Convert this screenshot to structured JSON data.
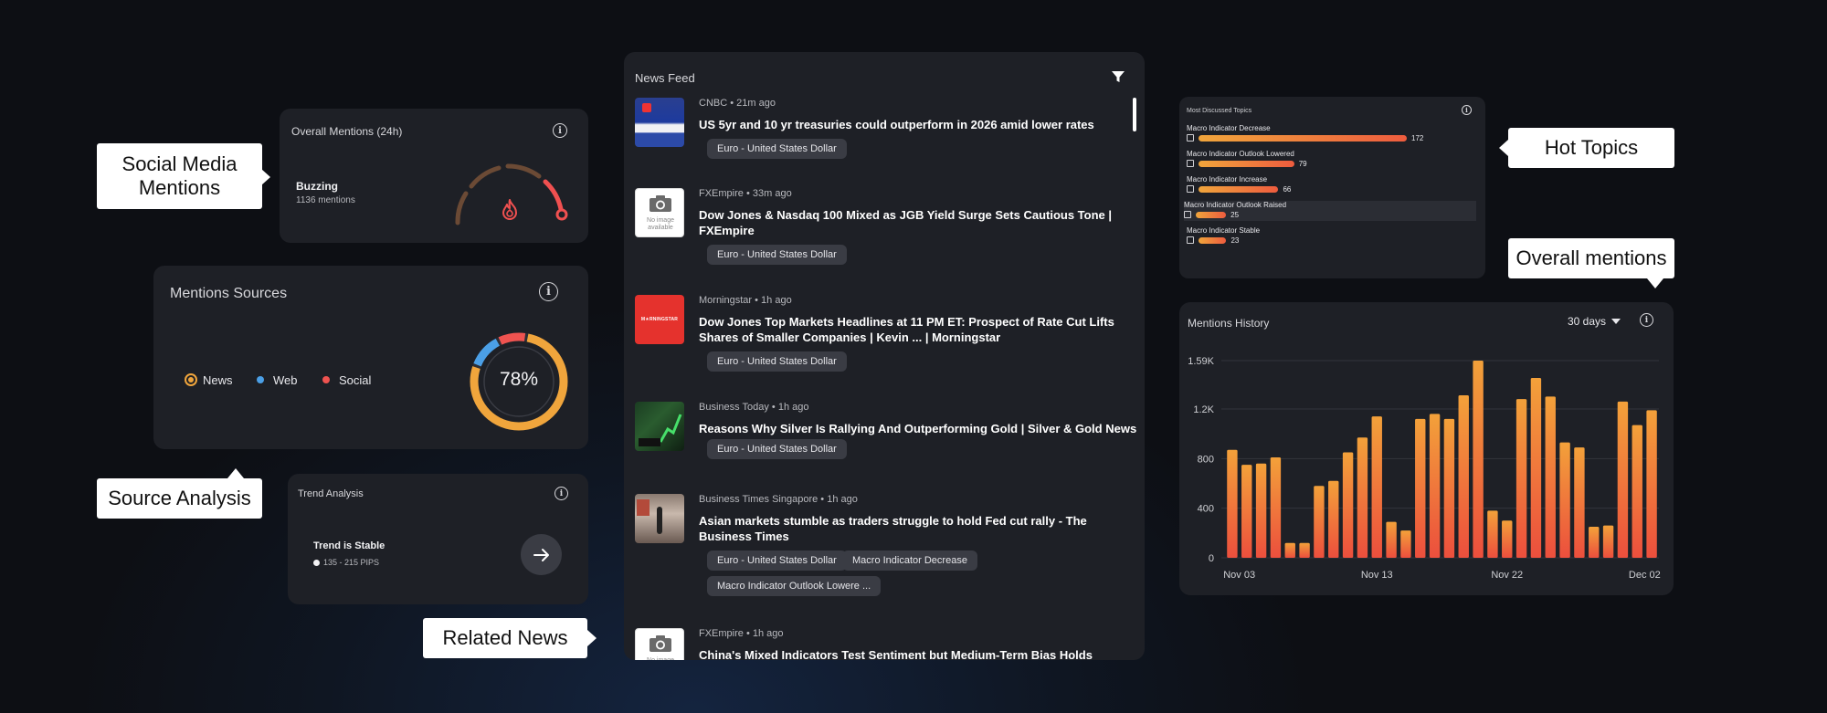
{
  "callouts": {
    "social_media": "Social Media\nMentions",
    "source_analysis": "Source Analysis",
    "related_news": "Related News",
    "hot_topics": "Hot Topics",
    "overall_mentions": "Overall mentions"
  },
  "overall_mentions": {
    "title": "Overall Mentions (24h)",
    "status": "Buzzing",
    "count_text": "1136 mentions",
    "gauge_level": 0.92,
    "colors": {
      "track": "#6b4a35",
      "active": "#f05050"
    }
  },
  "mentions_sources": {
    "title": "Mentions Sources",
    "legend": [
      {
        "label": "News",
        "color": "#f0a53c",
        "selected": true
      },
      {
        "label": "Web",
        "color": "#4b9fe6",
        "selected": false
      },
      {
        "label": "Social",
        "color": "#ef5350",
        "selected": false
      }
    ],
    "percent": "78%",
    "shares": {
      "news": 0.78,
      "web": 0.12,
      "social": 0.1
    }
  },
  "trend_analysis": {
    "title": "Trend Analysis",
    "status": "Trend is Stable",
    "range": "135 - 215 PIPS",
    "icon": "arrow-right-icon"
  },
  "news_feed": {
    "title": "News Feed",
    "items": [
      {
        "source": "CNBC",
        "time": "21m ago",
        "title": "US 5yr and 10 yr treasuries could outperform in 2026 amid lower rates",
        "tags": [
          "Euro - United States Dollar"
        ],
        "thumb": "cnbc"
      },
      {
        "source": "FXEmpire",
        "time": "33m ago",
        "title": "Dow Jones & Nasdaq 100 Mixed as JGB Yield Surge Sets Cautious Tone | FXEmpire",
        "tags": [
          "Euro - United States Dollar"
        ],
        "thumb": "noimage"
      },
      {
        "source": "Morningstar",
        "time": "1h ago",
        "title": "Dow Jones Top Markets Headlines at 11 PM ET: Prospect of Rate Cut Lifts Shares of Smaller Companies | Kevin ... | Morningstar",
        "tags": [
          "Euro - United States Dollar"
        ],
        "thumb": "morningstar"
      },
      {
        "source": "Business Today",
        "time": "1h ago",
        "title": "Reasons Why Silver Is Rallying And Outperforming Gold | Silver & Gold News",
        "tags": [
          "Euro - United States Dollar"
        ],
        "thumb": "silver"
      },
      {
        "source": "Business Times Singapore",
        "time": "1h ago",
        "title": "Asian markets stumble as traders struggle to hold Fed cut rally - The Business Times",
        "tags": [
          "Euro - United States Dollar",
          "Macro Indicator Decrease",
          "Macro Indicator Outlook Lowere ..."
        ],
        "thumb": "street"
      },
      {
        "source": "FXEmpire",
        "time": "1h ago",
        "title": "China's Mixed Indicators Test Sentiment but Medium-Term Bias Holds",
        "tags": [],
        "thumb": "noimage"
      }
    ],
    "no_image_text": "No image available",
    "morningstar_logo": "M★RNINGSTAR"
  },
  "hot_topics": {
    "title": "Most Discussed Topics",
    "items": [
      {
        "name": "Macro Indicator Decrease",
        "count": 172
      },
      {
        "name": "Macro Indicator Outlook Lowered",
        "count": 79
      },
      {
        "name": "Macro Indicator Increase",
        "count": 66
      },
      {
        "name": "Macro Indicator Outlook Raised",
        "count": 25,
        "highlighted": true
      },
      {
        "name": "Macro Indicator Stable",
        "count": 23
      }
    ],
    "max_count": 172
  },
  "mentions_history": {
    "title": "Mentions History",
    "range_select": "30 days",
    "colors": {
      "top": "#f3a13a",
      "bottom": "#ec4f3d"
    }
  },
  "chart_data": {
    "type": "bar",
    "title": "Mentions History",
    "y_ticks": [
      "0",
      "400",
      "800",
      "1.2K",
      "1.59K"
    ],
    "y_tick_values": [
      0,
      400,
      800,
      1200,
      1590
    ],
    "ylim": [
      0,
      1590
    ],
    "x_tick_labels": [
      "Nov 03",
      "Nov 13",
      "Nov 22",
      "Dec 02"
    ],
    "x_tick_indices": [
      0,
      10,
      19,
      29
    ],
    "values": [
      870,
      750,
      760,
      810,
      120,
      120,
      580,
      620,
      850,
      970,
      1140,
      290,
      220,
      1120,
      1160,
      1120,
      1310,
      1590,
      380,
      300,
      1280,
      1450,
      1300,
      930,
      890,
      250,
      260,
      1260,
      1070,
      1190
    ],
    "grid": true
  }
}
